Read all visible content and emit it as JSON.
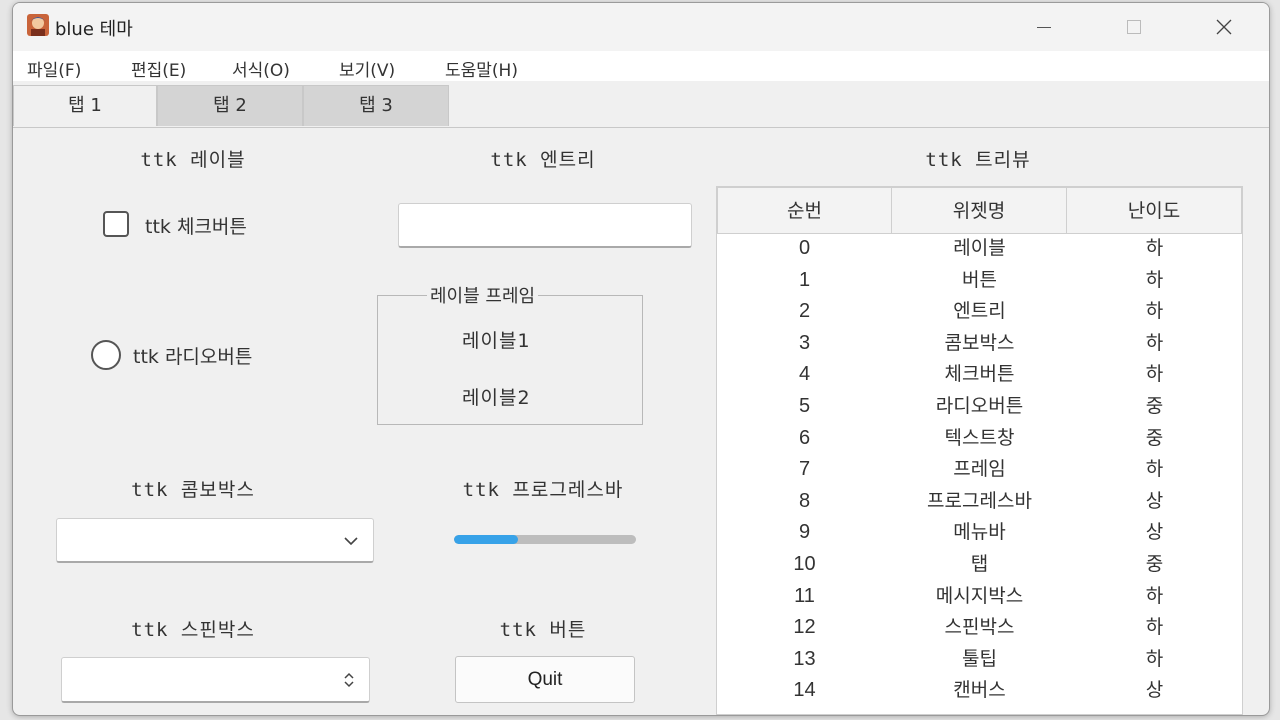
{
  "window": {
    "title": "blue 테마"
  },
  "menubar": [
    "파일(F)",
    "편집(E)",
    "서식(O)",
    "보기(V)",
    "도움말(H)"
  ],
  "tabs": [
    {
      "label": "탭 1",
      "active": true
    },
    {
      "label": "탭 2",
      "active": false
    },
    {
      "label": "탭 3",
      "active": false
    }
  ],
  "widgets": {
    "label_heading": "ttk 레이블",
    "entry_heading": "ttk 엔트리",
    "entry_value": "",
    "checkbutton_label": "ttk 체크버튼",
    "checkbutton_checked": false,
    "radiobutton_label": "ttk 라디오버튼",
    "radiobutton_selected": false,
    "labelframe_title": "레이블 프레임",
    "labelframe_label1": "레이블1",
    "labelframe_label2": "레이블2",
    "combobox_heading": "ttk 콤보박스",
    "combobox_value": "",
    "progressbar_heading": "ttk 프로그레스바",
    "progress_value_percent": 35,
    "spinbox_heading": "ttk 스핀박스",
    "spinbox_value": "",
    "button_heading": "ttk 버튼",
    "quit_label": "Quit",
    "treeview_heading": "ttk 트리뷰"
  },
  "treeview": {
    "columns": [
      "순번",
      "위젯명",
      "난이도"
    ],
    "rows": [
      [
        "0",
        "레이블",
        "하"
      ],
      [
        "1",
        "버튼",
        "하"
      ],
      [
        "2",
        "엔트리",
        "하"
      ],
      [
        "3",
        "콤보박스",
        "하"
      ],
      [
        "4",
        "체크버튼",
        "하"
      ],
      [
        "5",
        "라디오버튼",
        "중"
      ],
      [
        "6",
        "텍스트창",
        "중"
      ],
      [
        "7",
        "프레임",
        "하"
      ],
      [
        "8",
        "프로그레스바",
        "상"
      ],
      [
        "9",
        "메뉴바",
        "상"
      ],
      [
        "10",
        "탭",
        "중"
      ],
      [
        "11",
        "메시지박스",
        "하"
      ],
      [
        "12",
        "스핀박스",
        "하"
      ],
      [
        "13",
        "툴팁",
        "하"
      ],
      [
        "14",
        "캔버스",
        "상"
      ]
    ]
  },
  "colors": {
    "accent": "#37a2e8",
    "window_bg": "#f0f0f0",
    "progress_trough": "#bdbdbd"
  },
  "icons": {
    "app": "avatar-icon",
    "combobox_arrow": "chevron-down-icon",
    "spinbox_arrows": "up-down-chevron-icon"
  }
}
